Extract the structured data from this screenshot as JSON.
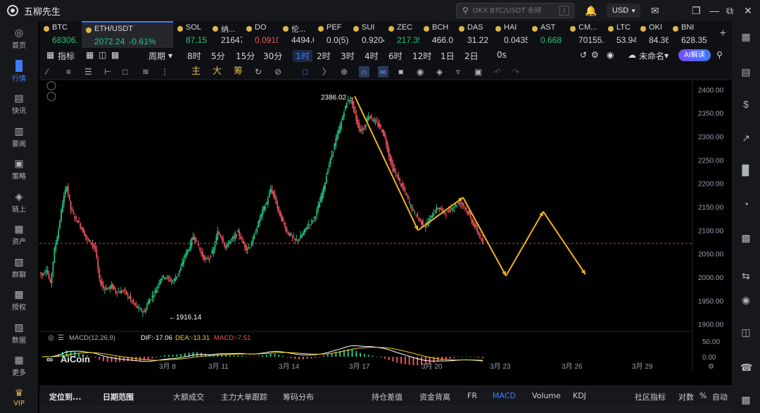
{
  "app": {
    "title": "五柳先生"
  },
  "search": {
    "placeholder": "OKX BTC/USDT 永续"
  },
  "currency": "USD",
  "sidebar": {
    "items": [
      {
        "label": "首页",
        "icon": "home-icon"
      },
      {
        "label": "行情",
        "icon": "chart-bars-icon",
        "active": true
      },
      {
        "label": "快讯",
        "icon": "news-flash-icon"
      },
      {
        "label": "要闻",
        "icon": "newspaper-icon"
      },
      {
        "label": "策略",
        "icon": "robot-icon"
      },
      {
        "label": "链上",
        "icon": "chain-icon"
      },
      {
        "label": "资产",
        "icon": "wallet-icon"
      },
      {
        "label": "群聊",
        "icon": "chat-icon"
      },
      {
        "label": "授权",
        "icon": "key-icon"
      },
      {
        "label": "数据",
        "icon": "database-icon"
      },
      {
        "label": "更多",
        "icon": "grid-icon"
      },
      {
        "label": "VIP",
        "icon": "crown-icon"
      }
    ]
  },
  "tickers": [
    {
      "sym": "BTC",
      "price": "68306.",
      "dir": "up"
    },
    {
      "sym": "ETH/USDT",
      "price": "2072.24",
      "change": "-0.61%",
      "dir": "up",
      "active": true
    },
    {
      "sym": "SOL",
      "price": "87.15",
      "dir": "up"
    },
    {
      "sym": "纳...",
      "price": "21647.",
      "dir": "neutral"
    },
    {
      "sym": "DO",
      "price": "0.0910",
      "dir": "down"
    },
    {
      "sym": "伦...",
      "price": "4494.0",
      "dir": "neutral"
    },
    {
      "sym": "PEF",
      "price": "0.0(5)3",
      "dir": "neutral"
    },
    {
      "sym": "SUI",
      "price": "0.9204",
      "dir": "neutral"
    },
    {
      "sym": "ZEC",
      "price": "217.39",
      "dir": "up"
    },
    {
      "sym": "BCH",
      "price": "466.0",
      "dir": "neutral"
    },
    {
      "sym": "DAS",
      "price": "31.22",
      "dir": "neutral"
    },
    {
      "sym": "HAI",
      "price": "0.0435",
      "dir": "neutral"
    },
    {
      "sym": "AST",
      "price": "0.668",
      "dir": "up"
    },
    {
      "sym": "CM...",
      "price": "70155.",
      "dir": "neutral"
    },
    {
      "sym": "LTC",
      "price": "53.94",
      "dir": "neutral"
    },
    {
      "sym": "OKI",
      "price": "84.36",
      "dir": "neutral"
    },
    {
      "sym": "BNI",
      "price": "628.35",
      "dir": "neutral"
    }
  ],
  "toolbar": {
    "indicator": "指标",
    "period": "周期",
    "timeframes": [
      "8时",
      "5分",
      "15分",
      "30分",
      "1时",
      "2时",
      "3时",
      "4时",
      "6时",
      "12时",
      "1日",
      "2日",
      "0s"
    ],
    "active_timeframe": "1时",
    "layout_name": "未命名",
    "ai_label": "AI解读",
    "tools_text": [
      "主",
      "大",
      "筹"
    ]
  },
  "chart_data": {
    "type": "candlestick",
    "price_axis": [
      "2400.00",
      "2350.00",
      "2300.00",
      "2250.00",
      "2200.00",
      "2150.00",
      "2100.00",
      "2050.00",
      "2000.00",
      "1950.00",
      "1900.00"
    ],
    "ylim": [
      1880,
      2420
    ],
    "current_price_line": 2072,
    "date_axis": [
      "3月 8",
      "3月 11",
      "3月 14",
      "3月 17",
      "3月 20",
      "3月 23",
      "3月 26",
      "3月 29"
    ],
    "high_label": "2386.02",
    "low_label": "1916.14",
    "macd": {
      "label": "MACD(12,26,9)",
      "dif": "DIF:-17.06",
      "dea": "DEA:-13.31",
      "macd": "MACD:-7.51",
      "axis": [
        "50.00",
        "0.00"
      ]
    },
    "drawn_path": [
      [
        2386,
        0
      ],
      [
        2100,
        1
      ],
      [
        2170,
        2
      ],
      [
        2003,
        3
      ],
      [
        2140,
        4
      ],
      [
        2006,
        5
      ]
    ],
    "watermark": "AiCoin",
    "close_series": [
      2004,
      2018,
      1986,
      2058,
      2102,
      2160,
      2196,
      2145,
      2128,
      2115,
      2098,
      2080,
      2075,
      2060,
      1995,
      1978,
      1975,
      1982,
      1970,
      1968,
      1972,
      1960,
      1948,
      1938,
      1930,
      1925,
      1948,
      1960,
      1975,
      1998,
      2002,
      1996,
      1990,
      2004,
      2020,
      2048,
      2062,
      2088,
      2074,
      2050,
      2036,
      2042,
      2058,
      2096,
      2085,
      2062,
      2078,
      2084,
      2096,
      2078,
      2061,
      2066,
      2089,
      2116,
      2142,
      2158,
      2188,
      2170,
      2138,
      2118,
      2097,
      2088,
      2078,
      2082,
      2094,
      2110,
      2118,
      2132,
      2160,
      2190,
      2230,
      2262,
      2294,
      2320,
      2355,
      2380,
      2372,
      2335,
      2312,
      2320,
      2346,
      2336,
      2328,
      2318,
      2298,
      2260,
      2230,
      2216,
      2196,
      2181,
      2158,
      2140,
      2128,
      2116,
      2108,
      2124,
      2138,
      2148,
      2142,
      2136,
      2144,
      2152,
      2158,
      2156,
      2144,
      2126,
      2108,
      2092,
      2072
    ]
  },
  "bottombar": {
    "items": [
      "定位到...",
      "日期范围",
      "大额成交",
      "主力大单跟踪",
      "筹码分布",
      "持仓差值",
      "资金背离",
      "FR",
      "MACD",
      "Volume",
      "KDJ",
      "社区指标",
      "对数",
      "%",
      "自动"
    ],
    "active": "MACD"
  }
}
